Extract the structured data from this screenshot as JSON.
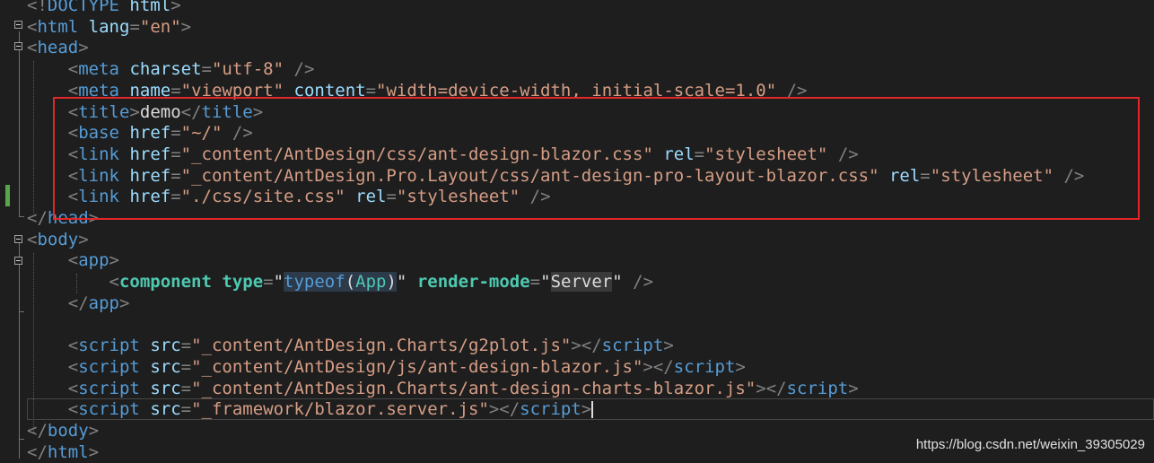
{
  "editor": {
    "lines": [
      {
        "id": "doctype",
        "tokens": [
          [
            "p",
            "<!"
          ],
          [
            "t",
            "DOCTYPE"
          ],
          [
            "x",
            " "
          ],
          [
            "a",
            "html"
          ],
          [
            "p",
            ">"
          ]
        ]
      },
      {
        "id": "html-open",
        "tokens": [
          [
            "p",
            "<"
          ],
          [
            "t",
            "html"
          ],
          [
            "x",
            " "
          ],
          [
            "a",
            "lang"
          ],
          [
            "p",
            "="
          ],
          [
            "s",
            "\"en\""
          ],
          [
            "p",
            ">"
          ]
        ]
      },
      {
        "id": "head-open",
        "tokens": [
          [
            "p",
            "<"
          ],
          [
            "t",
            "head"
          ],
          [
            "p",
            ">"
          ]
        ]
      },
      {
        "id": "meta-charset",
        "tokens": [
          [
            "x",
            "    "
          ],
          [
            "p",
            "<"
          ],
          [
            "t",
            "meta"
          ],
          [
            "x",
            " "
          ],
          [
            "a",
            "charset"
          ],
          [
            "p",
            "="
          ],
          [
            "s",
            "\"utf-8\""
          ],
          [
            "x",
            " "
          ],
          [
            "p",
            "/>"
          ]
        ]
      },
      {
        "id": "meta-viewport",
        "tokens": [
          [
            "x",
            "    "
          ],
          [
            "p",
            "<"
          ],
          [
            "t",
            "meta"
          ],
          [
            "x",
            " "
          ],
          [
            "a",
            "name"
          ],
          [
            "p",
            "="
          ],
          [
            "s",
            "\"viewport\""
          ],
          [
            "x",
            " "
          ],
          [
            "a",
            "content"
          ],
          [
            "p",
            "="
          ],
          [
            "s",
            "\"width=device-width, initial-scale=1.0\""
          ],
          [
            "x",
            " "
          ],
          [
            "p",
            "/>"
          ]
        ]
      },
      {
        "id": "title",
        "tokens": [
          [
            "x",
            "    "
          ],
          [
            "p",
            "<"
          ],
          [
            "t",
            "title"
          ],
          [
            "p",
            ">"
          ],
          [
            "x",
            "demo"
          ],
          [
            "p",
            "</"
          ],
          [
            "t",
            "title"
          ],
          [
            "p",
            ">"
          ]
        ]
      },
      {
        "id": "base",
        "tokens": [
          [
            "x",
            "    "
          ],
          [
            "p",
            "<"
          ],
          [
            "t",
            "base"
          ],
          [
            "x",
            " "
          ],
          [
            "a",
            "href"
          ],
          [
            "p",
            "="
          ],
          [
            "s",
            "\"~/\""
          ],
          [
            "x",
            " "
          ],
          [
            "p",
            "/>"
          ]
        ]
      },
      {
        "id": "link-ant-design",
        "tokens": [
          [
            "x",
            "    "
          ],
          [
            "p",
            "<"
          ],
          [
            "t",
            "link"
          ],
          [
            "x",
            " "
          ],
          [
            "a",
            "href"
          ],
          [
            "p",
            "="
          ],
          [
            "s",
            "\"_content/AntDesign/css/ant-design-blazor.css\""
          ],
          [
            "x",
            " "
          ],
          [
            "a",
            "rel"
          ],
          [
            "p",
            "="
          ],
          [
            "s",
            "\"stylesheet\""
          ],
          [
            "x",
            " "
          ],
          [
            "p",
            "/>"
          ]
        ]
      },
      {
        "id": "link-pro-layout",
        "tokens": [
          [
            "x",
            "    "
          ],
          [
            "p",
            "<"
          ],
          [
            "t",
            "link"
          ],
          [
            "x",
            " "
          ],
          [
            "a",
            "href"
          ],
          [
            "p",
            "="
          ],
          [
            "s",
            "\"_content/AntDesign.Pro.Layout/css/ant-design-pro-layout-blazor.css\""
          ],
          [
            "x",
            " "
          ],
          [
            "a",
            "rel"
          ],
          [
            "p",
            "="
          ],
          [
            "s",
            "\"stylesheet\""
          ],
          [
            "x",
            " "
          ],
          [
            "p",
            "/>"
          ]
        ]
      },
      {
        "id": "link-site",
        "tokens": [
          [
            "x",
            "    "
          ],
          [
            "p",
            "<"
          ],
          [
            "t",
            "link"
          ],
          [
            "x",
            " "
          ],
          [
            "a",
            "href"
          ],
          [
            "p",
            "="
          ],
          [
            "s",
            "\"./css/site.css\""
          ],
          [
            "x",
            " "
          ],
          [
            "a",
            "rel"
          ],
          [
            "p",
            "="
          ],
          [
            "s",
            "\"stylesheet\""
          ],
          [
            "x",
            " "
          ],
          [
            "p",
            "/>"
          ]
        ]
      },
      {
        "id": "head-close",
        "tokens": [
          [
            "p",
            "</"
          ],
          [
            "t",
            "head"
          ],
          [
            "p",
            ">"
          ]
        ]
      },
      {
        "id": "body-open",
        "tokens": [
          [
            "p",
            "<"
          ],
          [
            "t",
            "body"
          ],
          [
            "p",
            ">"
          ]
        ]
      },
      {
        "id": "app-open",
        "tokens": [
          [
            "x",
            "    "
          ],
          [
            "p",
            "<"
          ],
          [
            "t",
            "app"
          ],
          [
            "p",
            ">"
          ]
        ]
      },
      {
        "id": "component",
        "tokens": [
          [
            "x",
            "        "
          ],
          [
            "p",
            "<"
          ],
          [
            "c",
            "component"
          ],
          [
            "x",
            " "
          ],
          [
            "r",
            "type"
          ],
          [
            "p",
            "="
          ],
          [
            "x",
            "\""
          ],
          [
            "k",
            "typeof"
          ],
          [
            "pp",
            "("
          ],
          [
            "ty",
            "App"
          ],
          [
            "pp",
            ")"
          ],
          [
            "x",
            "\""
          ],
          [
            "x",
            " "
          ],
          [
            "r",
            "render-mode"
          ],
          [
            "p",
            "="
          ],
          [
            "x",
            "\""
          ],
          [
            "sv",
            "Server"
          ],
          [
            "x",
            "\""
          ],
          [
            "x",
            " "
          ],
          [
            "p",
            "/>"
          ]
        ]
      },
      {
        "id": "app-close",
        "tokens": [
          [
            "x",
            "    "
          ],
          [
            "p",
            "</"
          ],
          [
            "t",
            "app"
          ],
          [
            "p",
            ">"
          ]
        ]
      },
      {
        "id": "blank",
        "tokens": [
          [
            "x",
            ""
          ]
        ]
      },
      {
        "id": "script-g2plot",
        "tokens": [
          [
            "x",
            "    "
          ],
          [
            "p",
            "<"
          ],
          [
            "t",
            "script"
          ],
          [
            "x",
            " "
          ],
          [
            "a",
            "src"
          ],
          [
            "p",
            "="
          ],
          [
            "s",
            "\"_content/AntDesign.Charts/g2plot.js\""
          ],
          [
            "p",
            "></"
          ],
          [
            "t",
            "script"
          ],
          [
            "p",
            ">"
          ]
        ]
      },
      {
        "id": "script-ant-design",
        "tokens": [
          [
            "x",
            "    "
          ],
          [
            "p",
            "<"
          ],
          [
            "t",
            "script"
          ],
          [
            "x",
            " "
          ],
          [
            "a",
            "src"
          ],
          [
            "p",
            "="
          ],
          [
            "s",
            "\"_content/AntDesign/js/ant-design-blazor.js\""
          ],
          [
            "p",
            "></"
          ],
          [
            "t",
            "script"
          ],
          [
            "p",
            ">"
          ]
        ]
      },
      {
        "id": "script-charts",
        "tokens": [
          [
            "x",
            "    "
          ],
          [
            "p",
            "<"
          ],
          [
            "t",
            "script"
          ],
          [
            "x",
            " "
          ],
          [
            "a",
            "src"
          ],
          [
            "p",
            "="
          ],
          [
            "s",
            "\"_content/AntDesign.Charts/ant-design-charts-blazor.js\""
          ],
          [
            "p",
            "></"
          ],
          [
            "t",
            "script"
          ],
          [
            "p",
            ">"
          ]
        ]
      },
      {
        "id": "script-blazor-server",
        "tokens": [
          [
            "x",
            "    "
          ],
          [
            "p",
            "<"
          ],
          [
            "t",
            "script"
          ],
          [
            "x",
            " "
          ],
          [
            "a",
            "src"
          ],
          [
            "p",
            "="
          ],
          [
            "s",
            "\"_framework/blazor.server.js\""
          ],
          [
            "p",
            "></"
          ],
          [
            "t",
            "script"
          ],
          [
            "p",
            ">"
          ]
        ]
      },
      {
        "id": "body-close",
        "tokens": [
          [
            "p",
            "</"
          ],
          [
            "t",
            "body"
          ],
          [
            "p",
            ">"
          ]
        ]
      },
      {
        "id": "html-close",
        "tokens": [
          [
            "p",
            "</"
          ],
          [
            "t",
            "html"
          ],
          [
            "p",
            ">"
          ]
        ]
      }
    ]
  },
  "watermark": "https://blog.csdn.net/weixin_39305029",
  "colors": {
    "background": "#1e1e1e",
    "tag": "#569cd6",
    "attribute": "#9cdcfe",
    "string": "#d69d85",
    "punctuation": "#808080",
    "component": "#4ec9b0",
    "highlight_box": "#e0272b"
  }
}
